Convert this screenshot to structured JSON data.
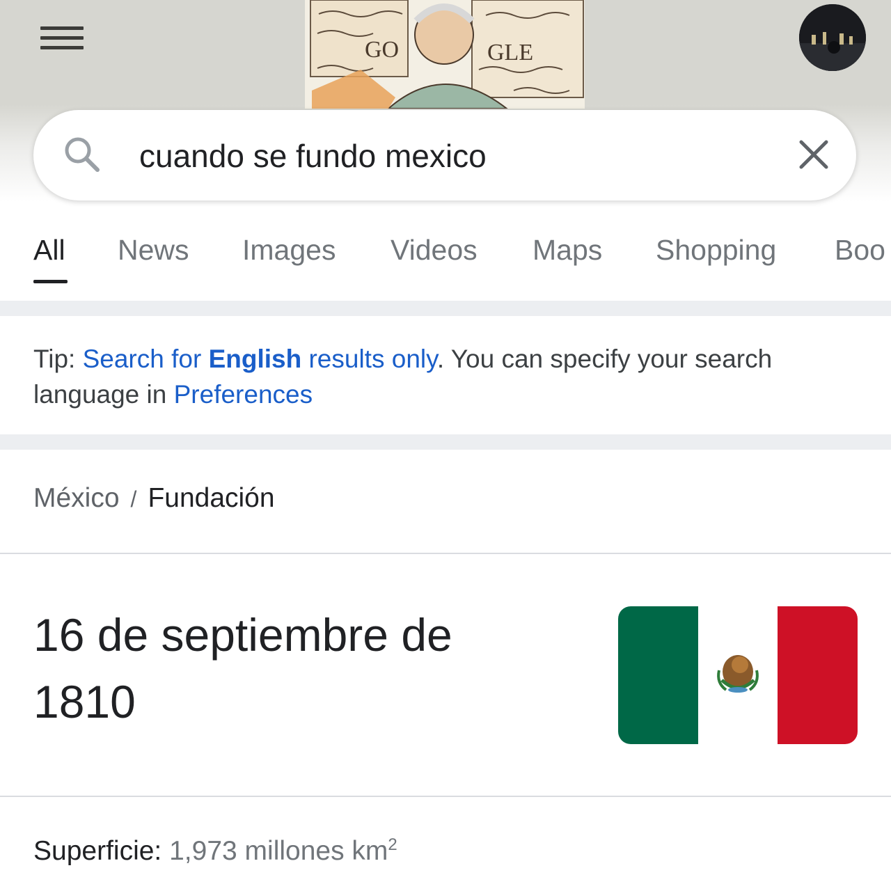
{
  "header": {
    "menu_icon": "hamburger-menu-icon",
    "doodle_fragments": [
      "GO",
      "GLE"
    ],
    "avatar_icon": "user-avatar"
  },
  "search": {
    "query": "cuando se fundo mexico",
    "search_icon": "search-icon",
    "clear_icon": "close-icon"
  },
  "tabs": [
    {
      "label": "All",
      "active": true
    },
    {
      "label": "News"
    },
    {
      "label": "Images"
    },
    {
      "label": "Videos"
    },
    {
      "label": "Maps"
    },
    {
      "label": "Shopping"
    },
    {
      "label": "Boo"
    }
  ],
  "tip": {
    "prefix": "Tip: ",
    "link1_before": "Search for ",
    "link1_bold": "English",
    "link1_after": " results only",
    "middle": ". You can specify your search language in ",
    "link2": "Preferences"
  },
  "knowledge": {
    "breadcrumb": [
      "México",
      "Fundación"
    ],
    "breadcrumb_sep": "/",
    "answer_line1": "16 de septiembre de",
    "answer_line2": "1810",
    "flag_colors": {
      "green": "#006847",
      "white": "#ffffff",
      "red": "#ce1126"
    },
    "facts": [
      {
        "label": "Superficie:",
        "value": "1,973 millones km",
        "unit_sup": "2"
      }
    ]
  },
  "colors": {
    "link": "#1a5ec9",
    "text_primary": "#202124",
    "text_secondary": "#70757a"
  }
}
